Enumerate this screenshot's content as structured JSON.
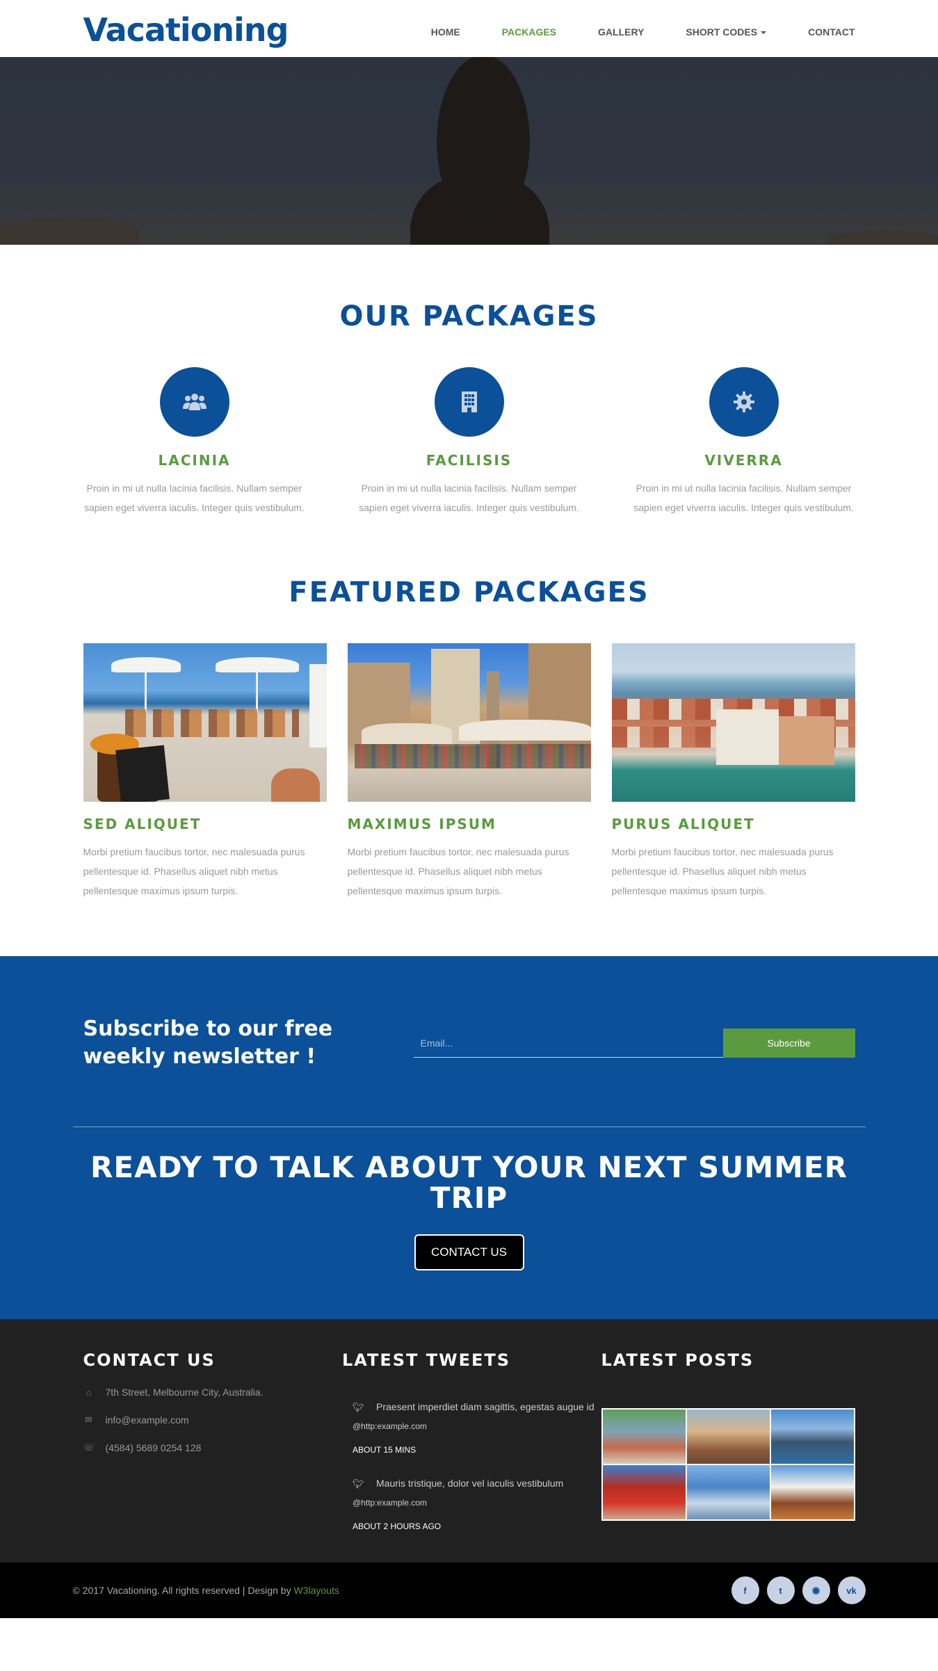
{
  "header": {
    "logo": "Vacationing",
    "nav": [
      {
        "label": "HOME",
        "active": false
      },
      {
        "label": "PACKAGES",
        "active": true
      },
      {
        "label": "GALLERY",
        "active": false
      },
      {
        "label": "SHORT CODES",
        "active": false,
        "dropdown": true
      },
      {
        "label": "CONTACT",
        "active": false
      }
    ]
  },
  "packages": {
    "title": "OUR PACKAGES",
    "items": [
      {
        "icon": "users-icon",
        "title": "LACINIA",
        "text": "Proin in mi ut nulla lacinia facilisis. Nullam semper sapien eget viverra iaculis. Integer quis vestibulum."
      },
      {
        "icon": "building-icon",
        "title": "FACILISIS",
        "text": "Proin in mi ut nulla lacinia facilisis. Nullam semper sapien eget viverra iaculis. Integer quis vestibulum."
      },
      {
        "icon": "gear-icon",
        "title": "VIVERRA",
        "text": "Proin in mi ut nulla lacinia facilisis. Nullam semper sapien eget viverra iaculis. Integer quis vestibulum."
      }
    ]
  },
  "featured": {
    "title": "FEATURED PACKAGES",
    "items": [
      {
        "title": "SED ALIQUET",
        "text": "Morbi pretium faucibus tortor, nec malesuada purus pellentesque id. Phasellus aliquet nibh metus pellentesque maximus ipsum turpis."
      },
      {
        "title": "MAXIMUS IPSUM",
        "text": "Morbi pretium faucibus tortor, nec malesuada purus pellentesque id. Phasellus aliquet nibh metus pellentesque maximus ipsum turpis."
      },
      {
        "title": "PURUS ALIQUET",
        "text": "Morbi pretium faucibus tortor, nec malesuada purus pellentesque id. Phasellus aliquet nibh metus pellentesque maximus ipsum turpis."
      }
    ]
  },
  "newsletter": {
    "text": "Subscribe to our free weekly newsletter !",
    "placeholder": "Email...",
    "button": "Subscribe"
  },
  "cta": {
    "title": "READY TO TALK ABOUT YOUR NEXT SUMMER TRIP",
    "button": "CONTACT US"
  },
  "footer": {
    "contact": {
      "title": "CONTACT US",
      "address": "7th Street, Melbourne City, Australia.",
      "email": "info@example.com",
      "phone": "(4584) 5689 0254 128"
    },
    "tweets": {
      "title": "LATEST TWEETS",
      "items": [
        {
          "text": "Praesent imperdiet diam sagittis, egestas augue id",
          "handle": "@http:example.com",
          "time": "ABOUT 15 MINS"
        },
        {
          "text": "Mauris tristique, dolor vel iaculis vestibulum",
          "handle": "@http:example.com",
          "time": "ABOUT 2 HOURS AGO"
        }
      ]
    },
    "posts": {
      "title": "LATEST POSTS"
    }
  },
  "copyright": {
    "text": "© 2017 Vacationing. All rights reserved | Design by ",
    "link": "W3layouts"
  },
  "socials": [
    {
      "icon": "facebook-icon",
      "glyph": "f"
    },
    {
      "icon": "twitter-icon",
      "glyph": "t"
    },
    {
      "icon": "rss-icon",
      "glyph": "◉"
    },
    {
      "icon": "vk-icon",
      "glyph": "vk"
    }
  ],
  "colors": {
    "brand_blue": "#0b5098",
    "accent_green": "#5b9a3f",
    "footer_bg": "#212121"
  }
}
